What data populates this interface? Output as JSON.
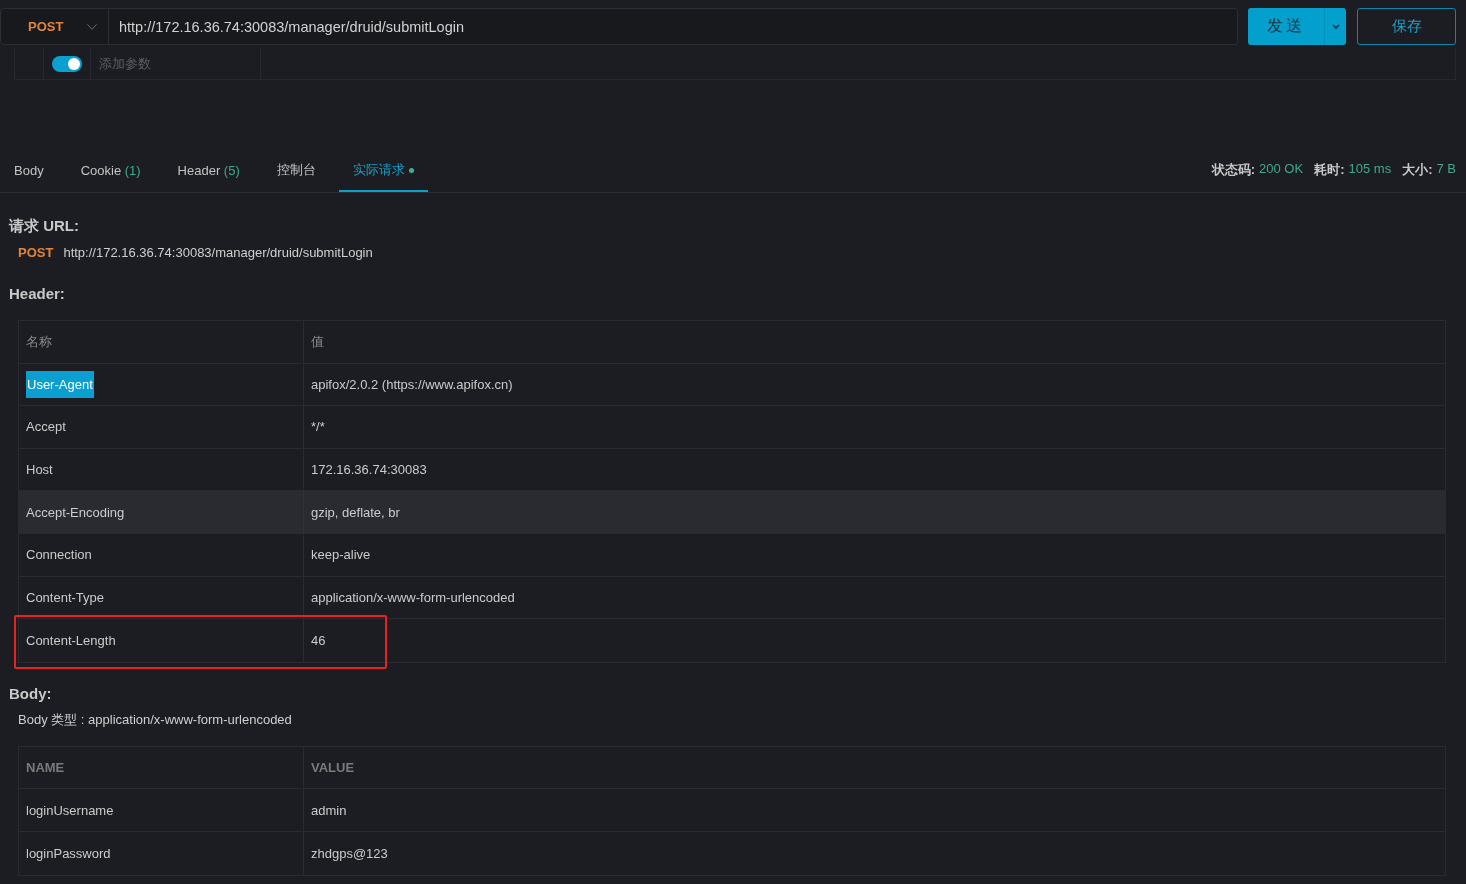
{
  "request_bar": {
    "method": "POST",
    "url": "http://172.16.36.74:30083/manager/druid/submitLogin",
    "send_button": "发送",
    "save_button": "保存"
  },
  "params": {
    "enabled": true,
    "placeholder": "添加参数"
  },
  "tabs": [
    {
      "label": "Body",
      "selected": false,
      "dot": false
    },
    {
      "label": "Cookie",
      "count": "(1)",
      "selected": false,
      "dot": false
    },
    {
      "label": "Header",
      "count": "(5)",
      "selected": false,
      "dot": false
    },
    {
      "label": "控制台",
      "selected": false,
      "dot": false
    },
    {
      "label": "实际请求",
      "selected": true,
      "dot": true
    }
  ],
  "status": [
    {
      "label": "状态码:",
      "value": "200 OK"
    },
    {
      "label": "耗时:",
      "value": "105 ms"
    },
    {
      "label": "大小:",
      "value": "7 B"
    }
  ],
  "request_url": {
    "title": "请求 URL:",
    "method": "POST",
    "url": "http://172.16.36.74:30083/manager/druid/submitLogin"
  },
  "header": {
    "title": "Header:",
    "columns": [
      "名称",
      "值"
    ],
    "rows": [
      {
        "name": "User-Agent",
        "value": "apifox/2.0.2 (https://www.apifox.cn)",
        "name_highlighted": true,
        "hovered": false,
        "annotated": false
      },
      {
        "name": "Accept",
        "value": "*/*",
        "name_highlighted": false,
        "hovered": false,
        "annotated": false
      },
      {
        "name": "Host",
        "value": "172.16.36.74:30083",
        "name_highlighted": false,
        "hovered": false,
        "annotated": false
      },
      {
        "name": "Accept-Encoding",
        "value": "gzip, deflate, br",
        "name_highlighted": false,
        "hovered": true,
        "annotated": false
      },
      {
        "name": "Connection",
        "value": "keep-alive",
        "name_highlighted": false,
        "hovered": false,
        "annotated": false
      },
      {
        "name": "Content-Type",
        "value": "application/x-www-form-urlencoded",
        "name_highlighted": false,
        "hovered": false,
        "annotated": false
      },
      {
        "name": "Content-Length",
        "value": "46",
        "name_highlighted": false,
        "hovered": false,
        "annotated": true
      }
    ]
  },
  "body": {
    "title": "Body:",
    "type_line": "Body 类型 : application/x-www-form-urlencoded",
    "columns": [
      "NAME",
      "VALUE"
    ],
    "rows": [
      {
        "name": "loginUsername",
        "value": "admin"
      },
      {
        "name": "loginPassword",
        "value": "zhdgps@123"
      }
    ]
  }
}
